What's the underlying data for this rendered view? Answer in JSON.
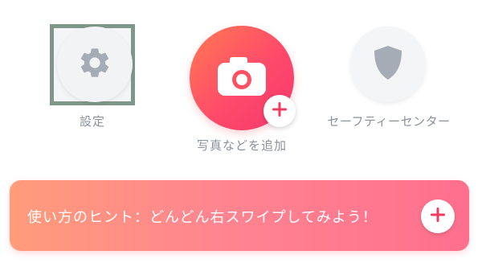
{
  "actions": {
    "settings": {
      "label": "設定",
      "icon": "gear-icon"
    },
    "camera": {
      "label": "写真などを追加",
      "icon": "camera-icon",
      "badge_icon": "plus-icon"
    },
    "safety": {
      "label": "セーフティーセンター",
      "icon": "shield-icon"
    }
  },
  "banner": {
    "text": "使い方のヒント：どんどん右スワイプしてみよう！",
    "button_icon": "plus-icon"
  },
  "colors": {
    "accent": "#ff4a6a",
    "plus": "#ef3b5d",
    "icon_gray": "#a6acb5",
    "label_gray": "#8b919c",
    "highlight_border": "#7f978a"
  }
}
